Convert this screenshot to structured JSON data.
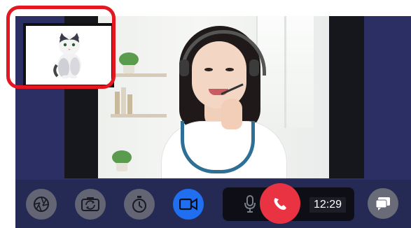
{
  "call": {
    "timer": "12:29"
  },
  "pip": {
    "subject": "cat"
  },
  "toolbar": {
    "buttons": [
      {
        "name": "aperture",
        "icon": "aperture-icon"
      },
      {
        "name": "camera-flip",
        "icon": "camera-flip-icon"
      },
      {
        "name": "timer",
        "icon": "stopwatch-icon"
      },
      {
        "name": "video",
        "icon": "video-camera-icon"
      },
      {
        "name": "microphone",
        "icon": "microphone-icon"
      },
      {
        "name": "end-call",
        "icon": "phone-hangup-icon"
      },
      {
        "name": "chat",
        "icon": "chat-bubble-icon"
      }
    ]
  },
  "colors": {
    "screen_bg": "#2b2f63",
    "toolbar_bg": "#252a55",
    "video_button": "#1f6ff0",
    "end_call": "#e93343",
    "highlight": "#e4161f"
  }
}
